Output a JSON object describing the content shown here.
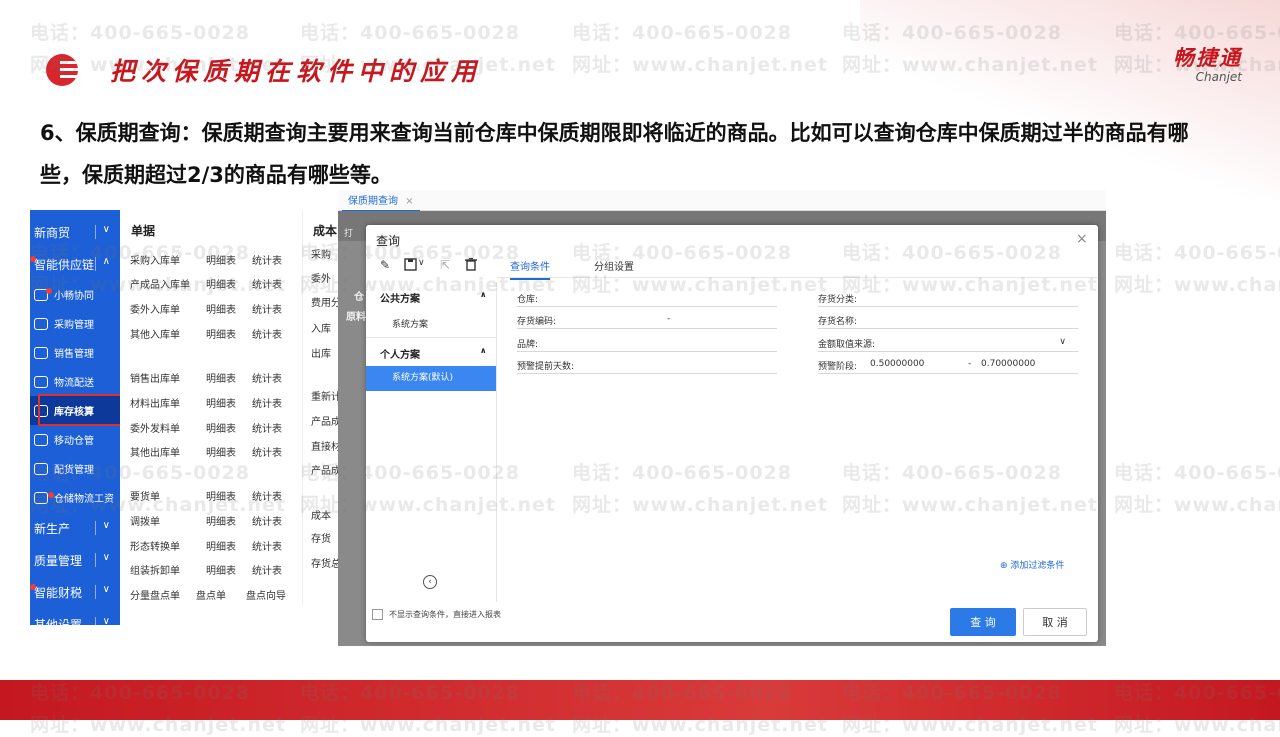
{
  "slide": {
    "title": "把次保质期在软件中的应用",
    "brand_cn": "畅捷通",
    "brand_en": "Chanjet",
    "paragraph": "6、保质期查询：保质期查询主要用来查询当前仓库中保质期限即将临近的商品。比如可以查询仓库中保质期过半的商品有哪些，保质期超过2/3的商品有哪些等。"
  },
  "watermark": {
    "phone": "电话：400-665-0028",
    "site": "网址：www.chanjet.net"
  },
  "nav": {
    "items": [
      {
        "label": "新商贸",
        "chev": "∨"
      },
      {
        "label": "智能供应链",
        "chev": "∧"
      }
    ],
    "sub": [
      {
        "label": "小畅协同",
        "icon": "collaboration-icon"
      },
      {
        "label": "采购管理",
        "icon": "purchase-icon"
      },
      {
        "label": "销售管理",
        "icon": "sales-icon"
      },
      {
        "label": "物流配送",
        "icon": "delivery-icon"
      },
      {
        "label": "库存核算",
        "icon": "inventory-icon"
      },
      {
        "label": "移动仓管",
        "icon": "mobile-warehouse-icon"
      },
      {
        "label": "配货管理",
        "icon": "allocation-icon"
      },
      {
        "label": "仓储物流工资",
        "icon": "wage-icon"
      }
    ],
    "bottom": [
      {
        "label": "新生产",
        "chev": "∨"
      },
      {
        "label": "质量管理",
        "chev": "∨"
      },
      {
        "label": "智能财税",
        "chev": "∨"
      },
      {
        "label": "其他设置",
        "chev": "∨"
      }
    ]
  },
  "menu": {
    "col1_title": "单据",
    "col2_title": "成本",
    "groups": [
      [
        "采购入库单",
        "明细表",
        "统计表"
      ],
      [
        "产成品入库单",
        "明细表",
        "统计表"
      ],
      [
        "委外入库单",
        "明细表",
        "统计表"
      ],
      [
        "其他入库单",
        "明细表",
        "统计表"
      ],
      [
        "销售出库单",
        "明细表",
        "统计表"
      ],
      [
        "材料出库单",
        "明细表",
        "统计表"
      ],
      [
        "委外发料单",
        "明细表",
        "统计表"
      ],
      [
        "其他出库单",
        "明细表",
        "统计表"
      ],
      [
        "要货单",
        "明细表",
        "统计表"
      ],
      [
        "调拨单",
        "明细表",
        "统计表"
      ],
      [
        "形态转换单",
        "明细表",
        "统计表"
      ],
      [
        "组装拆卸单",
        "明细表",
        "统计表"
      ],
      [
        "分量盘点单",
        "盘点单",
        "盘点向导"
      ]
    ],
    "col2": [
      "采购",
      "委外",
      "费用分",
      "入库",
      "出库",
      "重新计",
      "产品成",
      "直接材",
      "产品成",
      "成本",
      "存货",
      "存货总"
    ]
  },
  "app": {
    "tab": "保质期查询",
    "tab_close": "×",
    "bg_labels": [
      "打",
      "仓",
      "原料"
    ]
  },
  "dialog": {
    "title": "查询",
    "close": "×",
    "tabs": [
      "查询条件",
      "分组设置"
    ],
    "public_scheme": "公共方案",
    "public_item": "系统方案",
    "personal_scheme": "个人方案",
    "personal_item": "系统方案(默认)",
    "fields_left": [
      {
        "label": "仓库:",
        "value": ""
      },
      {
        "label": "存货编码:",
        "value": "-"
      },
      {
        "label": "品牌:",
        "value": ""
      },
      {
        "label": "预警提前天数:",
        "value": ""
      }
    ],
    "fields_right": [
      {
        "label": "存货分类:",
        "value": ""
      },
      {
        "label": "存货名称:",
        "value": ""
      },
      {
        "label": "金额取值来源:",
        "value": "∨"
      },
      {
        "label": "预警阶段:",
        "value_from": "0.50000000",
        "dash": "-",
        "value_to": "0.70000000"
      }
    ],
    "add_filter": "添加过滤条件",
    "footer_check": "不显示查询条件，直接进入报表",
    "query_btn": "查 询",
    "cancel_btn": "取 消"
  },
  "colors": {
    "accent_red": "#c8161d",
    "nav_blue": "#1d5fd6",
    "primary_blue": "#2b7ae8"
  }
}
